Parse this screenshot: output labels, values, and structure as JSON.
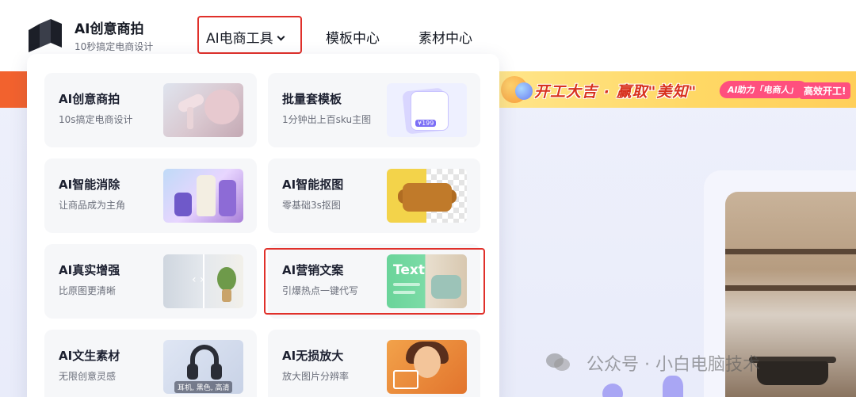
{
  "brand": {
    "title": "AI创意商拍",
    "subtitle": "10秒搞定电商设计"
  },
  "nav": {
    "tools_label": "AI电商工具",
    "templates_label": "模板中心",
    "materials_label": "素材中心"
  },
  "tools_menu": [
    {
      "title": "AI创意商拍",
      "desc": "10s搞定电商设计"
    },
    {
      "title": "批量套模板",
      "desc": "1分钟出上百sku主图",
      "badge": "¥199"
    },
    {
      "title": "AI智能消除",
      "desc": "让商品成为主角"
    },
    {
      "title": "AI智能抠图",
      "desc": "零基础3s抠图"
    },
    {
      "title": "AI真实增强",
      "desc": "比原图更清晰"
    },
    {
      "title": "AI营销文案",
      "desc": "引爆热点一键代写",
      "thumb_text": "Text"
    },
    {
      "title": "AI文生素材",
      "desc": "无限创意灵感",
      "thumb_caption": "耳机, 黑色, 高清"
    },
    {
      "title": "AI无损放大",
      "desc": "放大图片分辨率"
    }
  ],
  "banner": {
    "headline": "开工大吉 · 赢取\"美知\"",
    "pill": "AI助力「电商人」",
    "tail": "高效开工!"
  },
  "watermark": "公众号 · 小白电脑技术",
  "colors": {
    "highlight": "#e0302a",
    "brand_orange": "#f2622e",
    "banner_yellow": "#ffd865"
  }
}
